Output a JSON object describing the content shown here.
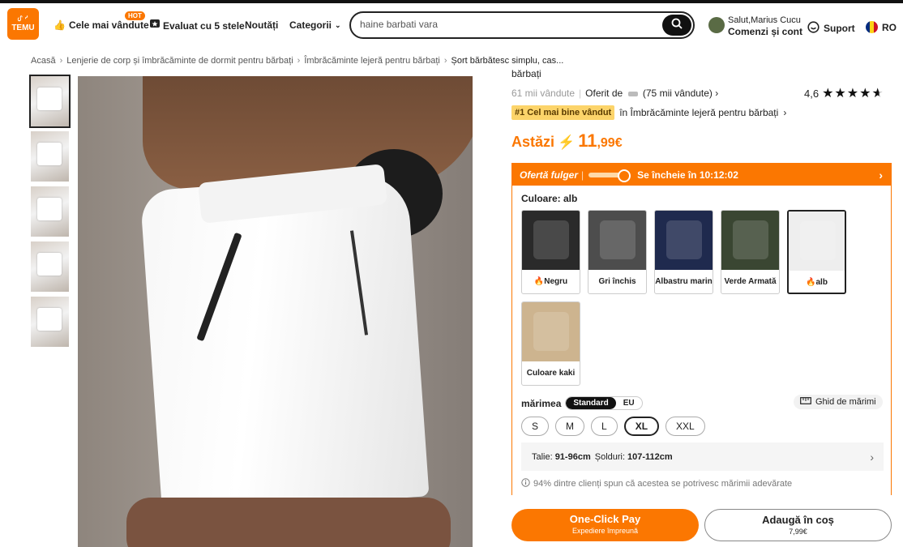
{
  "header": {
    "logo_text": "TEMU",
    "logo_symbol": "ᦔ ᔇ",
    "nav": {
      "bestsellers": "Cele mai vândute",
      "hot_badge": "HOT",
      "five_star": "Evaluat cu 5 stele",
      "news": "Noutăți",
      "categories": "Categorii"
    },
    "search": {
      "value": "haine barbati vara"
    },
    "user": {
      "greeting": "Salut,Marius Cucu",
      "orders": "Comenzi și cont"
    },
    "support": "Suport",
    "lang": "RO"
  },
  "breadcrumb": [
    "Acasă",
    "Lenjerie de corp și îmbrăcăminte de dormit pentru bărbați",
    "Îmbrăcăminte lejeră pentru bărbați",
    "Șort bărbătesc simplu, cas..."
  ],
  "product": {
    "title_tail": "bărbați",
    "sold": "61 mii vândute",
    "offered_by": "Oferit de",
    "seller_sold": "(75 mii vândute)",
    "rating": "4,6",
    "badge": "#1 Cel mai bine vândut",
    "badge_category": "în Îmbrăcăminte lejeră pentru bărbați",
    "price_label": "Astăzi",
    "price_int": "11",
    "price_dec": ",99€"
  },
  "flash": {
    "label": "Ofertă fulger",
    "ends": "Se încheie în 10:12:02"
  },
  "colors": {
    "label": "Culoare: alb",
    "items": [
      {
        "name": "Negru",
        "hot": true,
        "color": "#2a2a2a"
      },
      {
        "name": "Gri închis",
        "hot": false,
        "color": "#4d4d4d"
      },
      {
        "name": "Albastru marin",
        "hot": false,
        "color": "#1f2a4e"
      },
      {
        "name": "Verde Armată",
        "hot": false,
        "color": "#3a4632"
      },
      {
        "name": "alb",
        "hot": true,
        "color": "#eeeeee",
        "selected": true
      },
      {
        "name": "Culoare kaki",
        "hot": false,
        "color": "#cdb48f"
      }
    ]
  },
  "size": {
    "label": "mărimea",
    "toggle_standard": "Standard",
    "toggle_eu": "EU",
    "guide": "Ghid de mărimi",
    "options": [
      "S",
      "M",
      "L",
      "XL",
      "XXL"
    ],
    "selected": "XL",
    "waist_label": "Talie:",
    "waist": "91-96cm",
    "hip_label": "Șolduri:",
    "hip": "107-112cm",
    "fit_note": "94% dintre clienți spun că acestea se potrivesc mărimii adevărate"
  },
  "actions": {
    "pay": "One-Click Pay",
    "pay_sub": "Expediere împreună",
    "cart": "Adaugă în coș",
    "cart_price": "7,99€"
  },
  "theme": {
    "accent": "#fb7701"
  }
}
